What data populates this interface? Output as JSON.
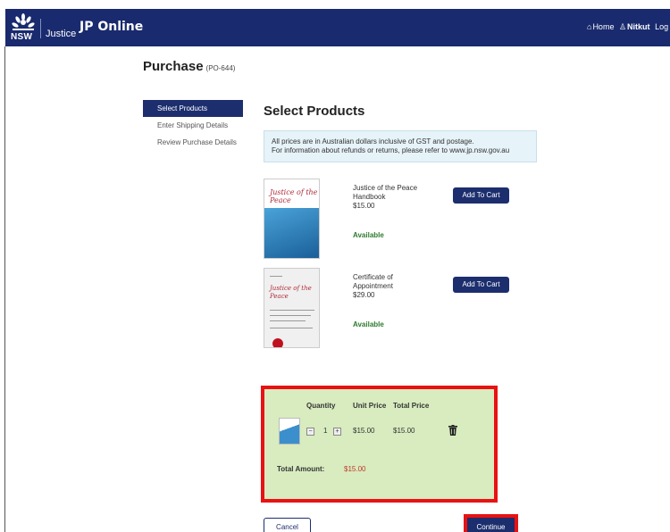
{
  "header": {
    "logo_text": "NSW",
    "brand": "Justice",
    "app_title": "JP Online",
    "nav": {
      "home": "Home",
      "user": "Nitkut",
      "logout": "Log o"
    }
  },
  "page": {
    "title": "Purchase",
    "code": "(PO-644)"
  },
  "steps": [
    {
      "label": "Select Products",
      "active": true
    },
    {
      "label": "Enter Shipping Details",
      "active": false
    },
    {
      "label": "Review Purchase Details",
      "active": false
    }
  ],
  "main": {
    "title": "Select Products",
    "info_line1": "All prices are in Australian dollars inclusive of GST and postage.",
    "info_line2": "For information about refunds or returns, please refer to www.jp.nsw.gov.au"
  },
  "products": [
    {
      "name": "Justice of the Peace Handbook",
      "price": "$15.00",
      "status": "Available",
      "button": "Add To Cart",
      "thumb_title": "Justice of the Peace"
    },
    {
      "name": "Certificate of Appointment",
      "price": "$29.00",
      "status": "Available",
      "button": "Add To Cart",
      "thumb_title": "Justice of the Peace"
    }
  ],
  "cart": {
    "headers": {
      "quantity": "Quantity",
      "unit_price": "Unit Price",
      "total_price": "Total Price"
    },
    "row": {
      "quantity": "1",
      "unit_price": "$15.00",
      "total_price": "$15.00",
      "minus": "−",
      "plus": "+"
    },
    "total_label": "Total Amount:",
    "total_value": "$15.00"
  },
  "buttons": {
    "cancel": "Cancel",
    "continue": "Continue"
  },
  "colors": {
    "header": "#192a6e",
    "primary": "#1c2e6e",
    "highlight": "#e81212",
    "cart_bg": "#d8ecbf",
    "available": "#2d7a2d"
  },
  "icons": {
    "home": "home-icon",
    "user": "user-icon",
    "trash": "trash-icon",
    "logo": "waratah-logo-icon"
  }
}
